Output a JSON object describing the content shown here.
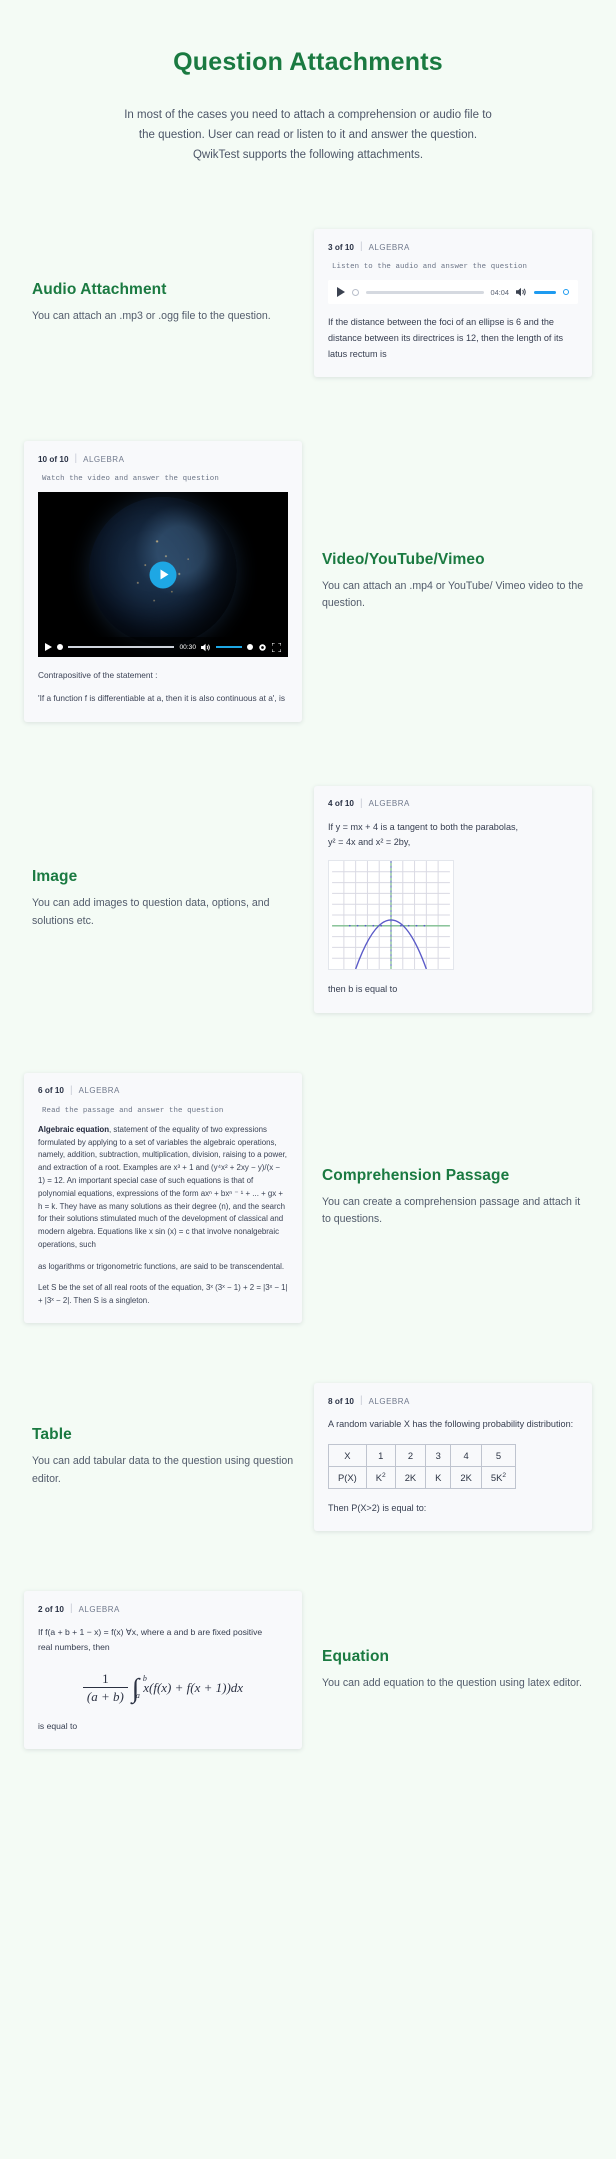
{
  "header": {
    "title": "Question Attachments",
    "subtitle": "In most of the cases you need to attach a comprehension or audio file to the question. User can read or listen to it and answer the question. QwikTest supports the following attachments."
  },
  "colors": {
    "page_background": "#f4fbf5",
    "heading_green": "#1a7a41",
    "card_background": "#f8f9fb",
    "accent_blue": "#1e9bf0",
    "play_button_blue": "#1ea7e4"
  },
  "sections": {
    "audio": {
      "heading": "Audio Attachment",
      "description": "You can attach an .mp3 or .ogg file to the question.",
      "card": {
        "question_number": "3 of 10",
        "separator": "|",
        "category": "ALGEBRA",
        "instruction": "Listen to the audio and answer the question",
        "player": {
          "duration": "04:04",
          "play_icon": "play-icon",
          "volume_icon": "volume-icon"
        },
        "question_text": "If the distance between the foci of an ellipse is 6 and the distance between its directrices is 12, then the length of its latus rectum is"
      }
    },
    "video": {
      "heading": "Video/YouTube/Vimeo",
      "description": "You can attach an .mp4 or YouTube/ Vimeo video to the question.",
      "card": {
        "question_number": "10 of 10",
        "separator": "|",
        "category": "ALGEBRA",
        "instruction": "Watch the video and answer the question",
        "player": {
          "duration": "00:30",
          "play_icon": "play-icon",
          "volume_icon": "volume-icon",
          "settings_icon": "gear-icon",
          "fullscreen_icon": "fullscreen-icon"
        },
        "caption_line1": "Contrapositive of the statement :",
        "caption_line2": "'If a function f is differentiable at a, then it is also continuous at a', is"
      }
    },
    "image": {
      "heading": "Image",
      "description": "You can add images to question data, options, and solutions etc.",
      "card": {
        "question_number": "4 of 10",
        "separator": "|",
        "category": "ALGEBRA",
        "question_line1": "If y = mx + 4 is a tangent to both the parabolas,",
        "question_line2": "y² = 4x and x² = 2by,",
        "question_line3": "then b is equal to",
        "graph_alt": "parabola-graph"
      }
    },
    "comprehension": {
      "heading": "Comprehension Passage",
      "description": "You can create a comprehension passage and attach it to questions.",
      "card": {
        "question_number": "6 of 10",
        "separator": "|",
        "category": "ALGEBRA",
        "instruction": "Read the passage and answer the question",
        "passage_lead": "Algebraic equation",
        "passage_body": ", statement of the equality of two expressions formulated by applying to a set of variables the algebraic operations, namely, addition, subtraction, multiplication, division, raising to a power, and extraction of a root. Examples are x³ + 1 and (y⁴x² + 2xy − y)/(x − 1) = 12. An important special case of such equations is that of polynomial equations, expressions of the form axⁿ + bxⁿ ⁻ ¹ + ... + gx + h = k. They have as many solutions as their degree (n), and the search for their solutions stimulated much of the development of classical and modern algebra. Equations like x sin (x) = c that involve nonalgebraic operations, such",
        "passage_body2": "as logarithms or trigonometric functions, are said to be transcendental.",
        "question_text": "Let S be the set of all real roots of the equation, 3ˣ (3ˣ − 1) + 2 = |3ˣ − 1| + |3ˣ − 2|. Then S is a singleton."
      }
    },
    "table": {
      "heading": "Table",
      "description": "You can add tabular data to the question using question editor.",
      "card": {
        "question_number": "8 of 10",
        "separator": "|",
        "category": "ALGEBRA",
        "question_text": "A random variable X has the following probability distribution:",
        "table": {
          "rows": [
            [
              "X",
              "1",
              "2",
              "3",
              "4",
              "5"
            ],
            [
              "P(X)",
              "K2",
              "2K",
              "K",
              "2K",
              "5K2"
            ]
          ]
        },
        "footer_text": "Then P(X>2) is equal to:"
      }
    },
    "equation": {
      "heading": "Equation",
      "description": "You can add equation to the question using latex editor.",
      "card": {
        "question_number": "2 of 10",
        "separator": "|",
        "category": "ALGEBRA",
        "question_line1": "If f(a + b + 1 − x) = f(x) ∀x, where a and b are fixed positive",
        "question_line2": "real numbers, then",
        "equation": {
          "fraction_numerator": "1",
          "fraction_denominator": "(a + b)",
          "integral_upper": "b",
          "integral_lower": "a",
          "integrand": "x(f(x) + f(x + 1))dx"
        },
        "footer_text": "is equal to"
      }
    }
  }
}
